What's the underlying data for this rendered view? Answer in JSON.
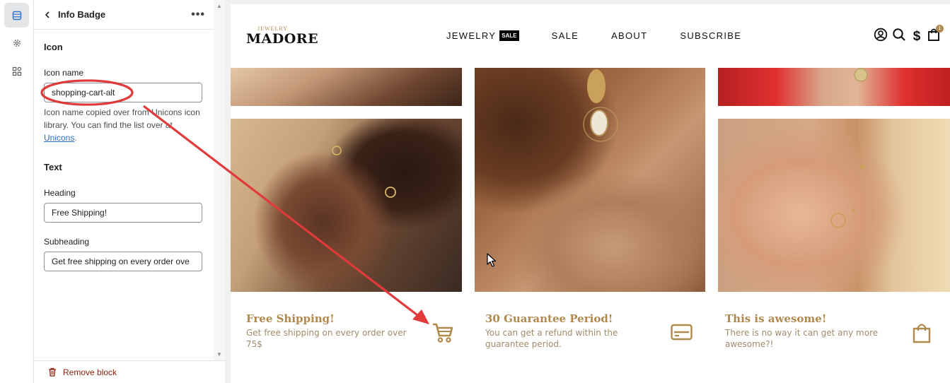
{
  "editor": {
    "header": {
      "title": "Info Badge",
      "more": "•••"
    },
    "icon_section": {
      "title": "Icon",
      "icon_name_label": "Icon name",
      "icon_name_value": "shopping-cart-alt",
      "help_text": "Icon name copied over from Unicons icon library. You can find the list over at ",
      "help_link": "Unicons",
      "help_end": "."
    },
    "text_section": {
      "title": "Text",
      "heading_label": "Heading",
      "heading_value": "Free Shipping!",
      "subheading_label": "Subheading",
      "subheading_value": "Get free shipping on every order ove"
    },
    "remove_label": "Remove block",
    "rail_icons": [
      "sections-icon",
      "settings-gear-icon",
      "apps-icon"
    ]
  },
  "store": {
    "logo": {
      "small": "JEWELRY",
      "big": "MADORE"
    },
    "nav": [
      {
        "label": "JEWELRY",
        "badge": "SALE"
      },
      {
        "label": "SALE"
      },
      {
        "label": "ABOUT"
      },
      {
        "label": "SUBSCRIBE"
      }
    ],
    "header_icons": [
      "account-icon",
      "search-icon",
      "currency-dollar-icon",
      "bag-icon"
    ],
    "currency_symbol": "$",
    "cart_count": "1",
    "badges": [
      {
        "title": "Free Shipping!",
        "subtitle": "Get free shipping on every order over 75$",
        "icon": "shopping-cart-icon"
      },
      {
        "title": "30 Guarantee Period!",
        "subtitle": "You can get a refund within the guarantee period.",
        "icon": "credit-card-icon"
      },
      {
        "title": "This is awesome!",
        "subtitle": "There is no way it can get any more awesome?!",
        "icon": "shopping-bag-icon"
      }
    ]
  },
  "colors": {
    "gold": "#b0894e",
    "annotation_red": "#e03a3a",
    "link": "#2c6ecb",
    "danger": "#8e1f0b"
  }
}
